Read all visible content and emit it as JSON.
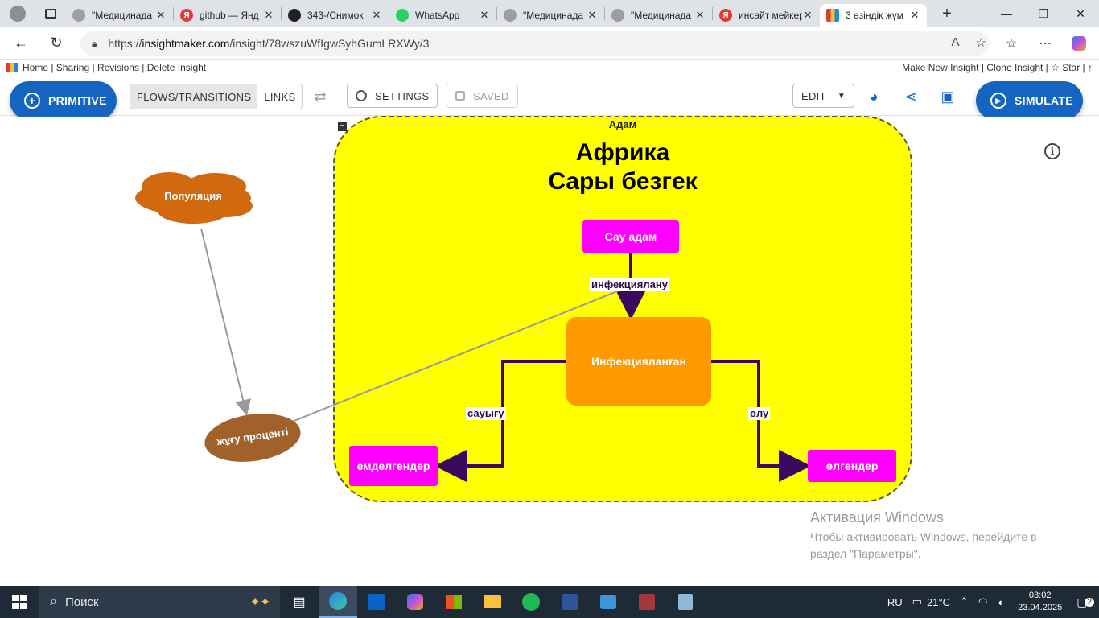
{
  "browser": {
    "tabs": [
      {
        "title": "\"Медицинада",
        "icon": "globe-icon",
        "color": "#9e9e9e"
      },
      {
        "title": "github — Янд",
        "icon": "yandex-icon",
        "color": "#e53935"
      },
      {
        "title": "343-/Снимок",
        "icon": "github-icon",
        "color": "#222222"
      },
      {
        "title": "WhatsApp",
        "icon": "whatsapp-icon",
        "color": "#25d366"
      },
      {
        "title": "\"Медицинада",
        "icon": "globe-icon",
        "color": "#9e9e9e"
      },
      {
        "title": "\"Медицинада",
        "icon": "globe-icon",
        "color": "#9e9e9e"
      },
      {
        "title": "инсайт мейкер",
        "icon": "yandex-icon",
        "color": "#e53935"
      },
      {
        "title": "3 өзіндік жұм",
        "icon": "insightmaker-icon",
        "color": "#1e88e5",
        "active": true
      }
    ],
    "url_prefix": "https://",
    "url_domain": "insightmaker.com",
    "url_path": "/insight/78wszuWfIgwSyhGumLRXWy/3"
  },
  "site": {
    "left_links": "Home | Sharing | Revisions | Delete Insight",
    "right_links": "Make New Insight | Clone Insight | ☆ Star | ↑"
  },
  "toolbar": {
    "primitive": "PRIMITIVE",
    "flows": "FLOWS/TRANSITIONS",
    "links": "LINKS",
    "settings": "SETTINGS",
    "saved": "SAVED",
    "edit": "EDIT",
    "simulate": "SIMULATE"
  },
  "model": {
    "folder_label": "Адам",
    "title_line1": "Африка",
    "title_line2": "Сары безгек",
    "stocks": {
      "healthy": "Сау адам",
      "infected": "Инфекцияланған",
      "recovered": "емделгендер",
      "dead": "өлгендер"
    },
    "flows": {
      "infection": "инфекциялану",
      "recovery": "сауығу",
      "death": "өлу"
    },
    "variables": {
      "population": "Популяция",
      "infection_rate": "жұғу проценті"
    },
    "colors": {
      "folder": "#ffff00",
      "stock": "#ff00ff",
      "infected": "#ff9900",
      "population": "#d2690e",
      "rate": "#a0612a",
      "flow": "#3a0a5e"
    }
  },
  "watermark": {
    "line1": "Активация Windows",
    "line2": "Чтобы активировать Windows, перейдите в раздел \"Параметры\"."
  },
  "taskbar": {
    "search": "Поиск",
    "lang": "RU",
    "weather": "21°C",
    "time": "03:02",
    "date": "23.04.2025",
    "notifications": "2"
  }
}
